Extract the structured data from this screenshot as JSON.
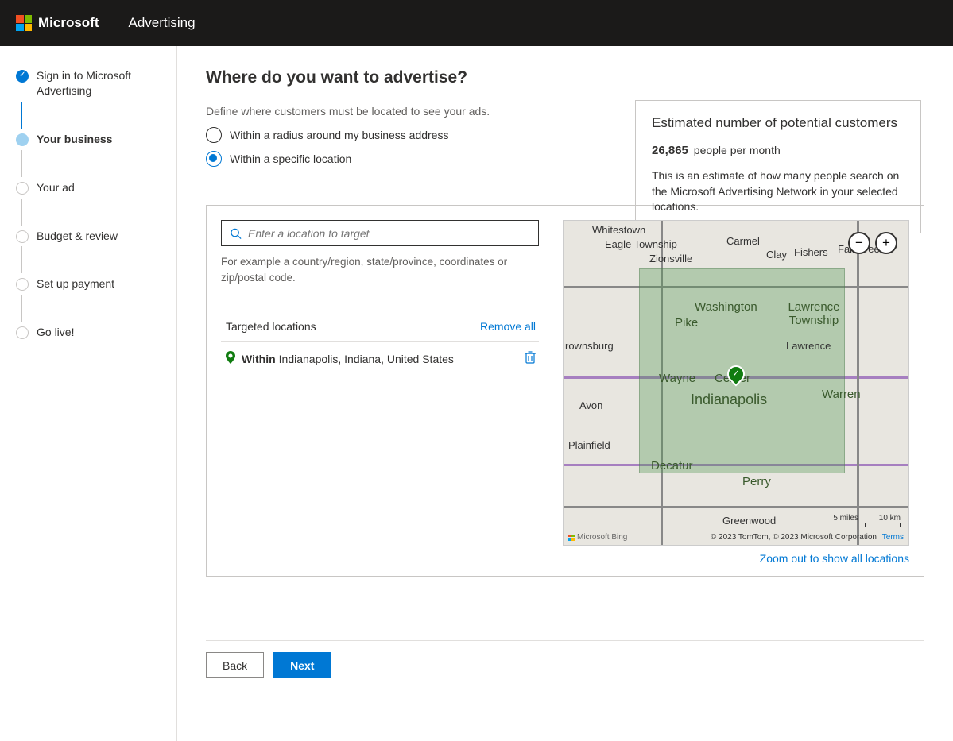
{
  "header": {
    "brand": "Microsoft",
    "product": "Advertising"
  },
  "steps": [
    {
      "label": "Sign in to Microsoft Advertising",
      "state": "done"
    },
    {
      "label": "Your business",
      "state": "current"
    },
    {
      "label": "Your ad",
      "state": "future"
    },
    {
      "label": "Budget & review",
      "state": "future"
    },
    {
      "label": "Set up payment",
      "state": "future"
    },
    {
      "label": "Go live!",
      "state": "future"
    }
  ],
  "page": {
    "title": "Where do you want to advertise?",
    "subtitle": "Define where customers must be located to see your ads.",
    "radio_options": {
      "radius": "Within a radius around my business address",
      "specific": "Within a specific location"
    },
    "selected_option": "specific"
  },
  "estimate": {
    "title": "Estimated number of potential customers",
    "count": "26,865",
    "unit": "people per month",
    "description": "This is an estimate of how many people search on the Microsoft Advertising Network in your selected locations."
  },
  "search": {
    "placeholder": "Enter a location to target",
    "example": "For example a country/region, state/province, coordinates or zip/postal code."
  },
  "targeted": {
    "heading": "Targeted locations",
    "remove_all": "Remove all",
    "items": [
      {
        "prefix": "Within",
        "location": "Indianapolis, Indiana, United States"
      }
    ]
  },
  "map": {
    "zoom_out_link": "Zoom out to show all locations",
    "attribution": "© 2023 TomTom, © 2023 Microsoft Corporation",
    "terms": "Terms",
    "provider": "Microsoft Bing",
    "scale_miles": "5 miles",
    "scale_km": "10 km",
    "labels": {
      "whitestown": "Whitestown",
      "eagle": "Eagle Township",
      "zionsville": "Zionsville",
      "carmel": "Carmel",
      "clay": "Clay",
      "fishers": "Fishers",
      "fallcreek": "Fall Creek",
      "washington": "Washington",
      "pike": "Pike",
      "lawrence_twp": "Lawrence Township",
      "lawrence": "Lawrence",
      "brownsburg": "rownsburg",
      "wayne": "Wayne",
      "center": "Center",
      "indianapolis": "Indianapolis",
      "warren": "Warren",
      "avon": "Avon",
      "plainfield": "Plainfield",
      "decatur": "Decatur",
      "perry": "Perry",
      "greenwood": "Greenwood"
    }
  },
  "footer": {
    "back": "Back",
    "next": "Next"
  }
}
